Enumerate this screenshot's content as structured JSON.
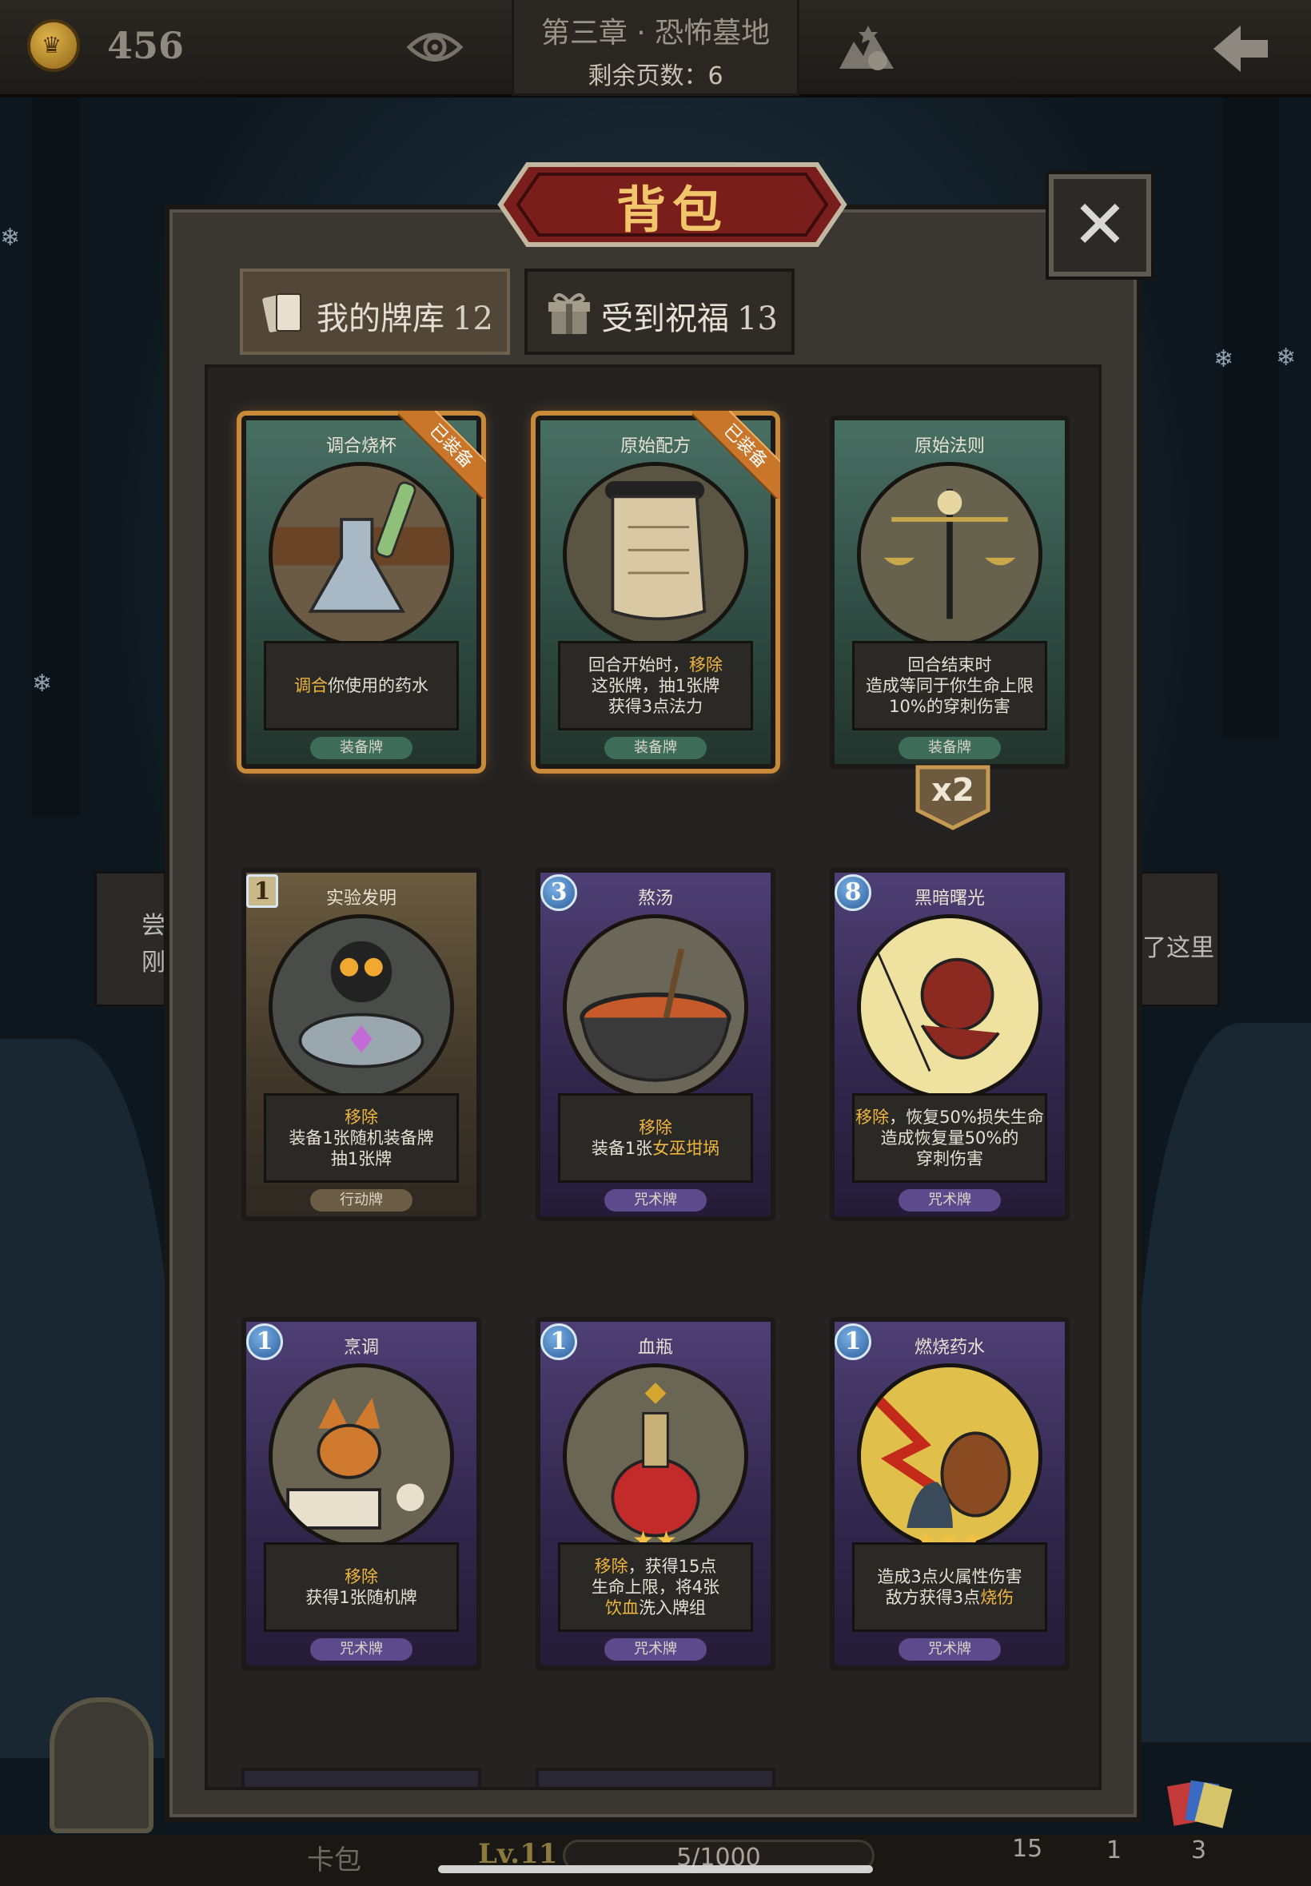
{
  "top_bar": {
    "gold": "456",
    "chapter_title": "第三章 · 恐怖墓地",
    "pages_left": "剩余页数：6"
  },
  "modal": {
    "title": "背包",
    "tabs": [
      {
        "label": "我的牌库",
        "count": "12"
      },
      {
        "label": "受到祝福",
        "count": "13"
      }
    ]
  },
  "cards": [
    {
      "name": "调合烧杯",
      "type": "装备牌",
      "badge": "已装备",
      "desc": [
        "调合你使用的药水"
      ]
    },
    {
      "name": "原始配方",
      "type": "装备牌",
      "badge": "已装备",
      "desc": [
        "回合开始时，移除",
        "这张牌，抽1张牌",
        "获得3点法力"
      ]
    },
    {
      "name": "原始法则",
      "type": "装备牌",
      "multiplier": "x2",
      "desc": [
        "回合结束时",
        "造成等同于你生命上限",
        "10%的穿刺伤害"
      ]
    },
    {
      "name": "实验发明",
      "type": "行动牌",
      "cost": "1",
      "desc": [
        "移除",
        "装备1张随机装备牌",
        "抽1张牌"
      ]
    },
    {
      "name": "熬汤",
      "type": "咒术牌",
      "cost": "3",
      "desc": [
        "移除",
        "装备1张女巫坩埚"
      ]
    },
    {
      "name": "黑暗曙光",
      "type": "咒术牌",
      "cost": "8",
      "desc": [
        "移除，恢复50%损失生命",
        "造成恢复量50%的",
        "穿刺伤害"
      ]
    },
    {
      "name": "烹调",
      "type": "咒术牌",
      "cost": "1",
      "desc": [
        "移除",
        "获得1张随机牌"
      ]
    },
    {
      "name": "血瓶",
      "type": "咒术牌",
      "cost": "1",
      "stars": "★★",
      "desc": [
        "移除，获得15点",
        "生命上限，将4张",
        "饮血洗入牌组"
      ]
    },
    {
      "name": "燃烧药水",
      "type": "咒术牌",
      "cost": "1",
      "stars": "★★★",
      "desc": [
        "造成3点火属性伤害",
        "敌方获得3点烧伤"
      ]
    }
  ],
  "background": {
    "left_text": [
      "尝",
      "刚"
    ],
    "right_text": "了这里"
  },
  "bottom_bar": {
    "left_label": "卡包",
    "level": "Lv.11",
    "xp": "5/1000",
    "counts": [
      "15",
      "1",
      "3"
    ]
  },
  "colors": {
    "accent": "#f0b63c",
    "equip": "#3d6c5a",
    "spell": "#5b4a8c",
    "action": "#6b5c46"
  }
}
